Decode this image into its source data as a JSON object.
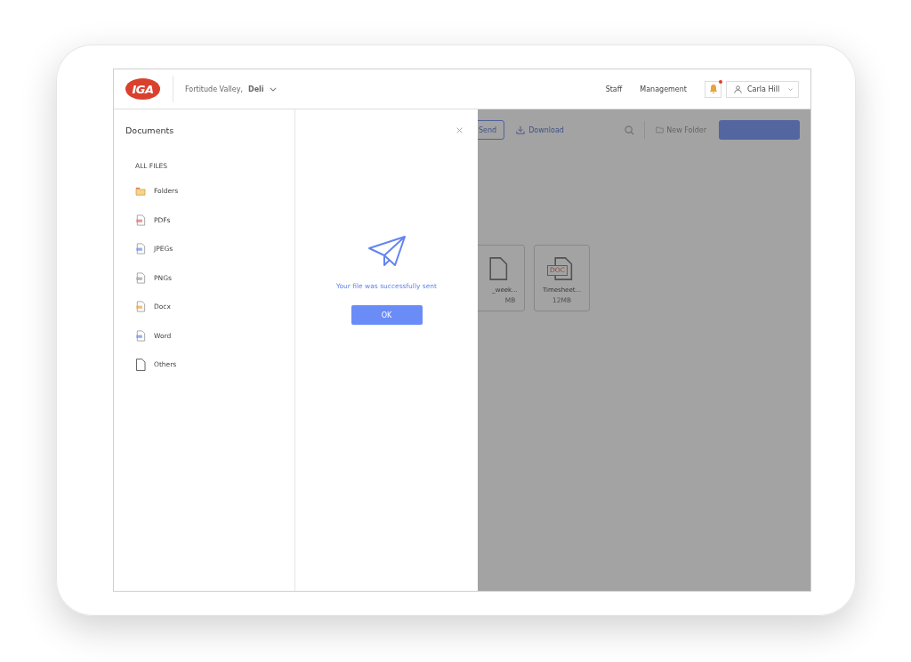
{
  "header": {
    "logo": "IGA",
    "location": "Fortitude Valley, **Deli**",
    "nav": [
      "Staff",
      "Management"
    ],
    "notifications": {
      "unread": true
    },
    "user": {
      "name": "Carla Hill"
    }
  },
  "sidebar": {
    "title": "Documents",
    "section": "ALL FILES",
    "items": [
      {
        "label": "Folders",
        "kind": "folder"
      },
      {
        "label": "PDFs",
        "kind": "pdf"
      },
      {
        "label": "JPEGs",
        "kind": "jpeg"
      },
      {
        "label": "PNGs",
        "kind": "png"
      },
      {
        "label": "Docx",
        "kind": "docx"
      },
      {
        "label": "Word",
        "kind": "word"
      },
      {
        "label": "Others",
        "kind": "other"
      }
    ]
  },
  "modal": {
    "message": "Your file was successfully sent",
    "button": "OK"
  },
  "background": {
    "toolbar": {
      "send": "Send",
      "download": "Download",
      "new_folder": "New Folder"
    },
    "files": [
      {
        "name": "_week...",
        "size": "MB"
      },
      {
        "name": "Timesheet...",
        "size": "12MB",
        "badge": "DOC"
      }
    ]
  }
}
